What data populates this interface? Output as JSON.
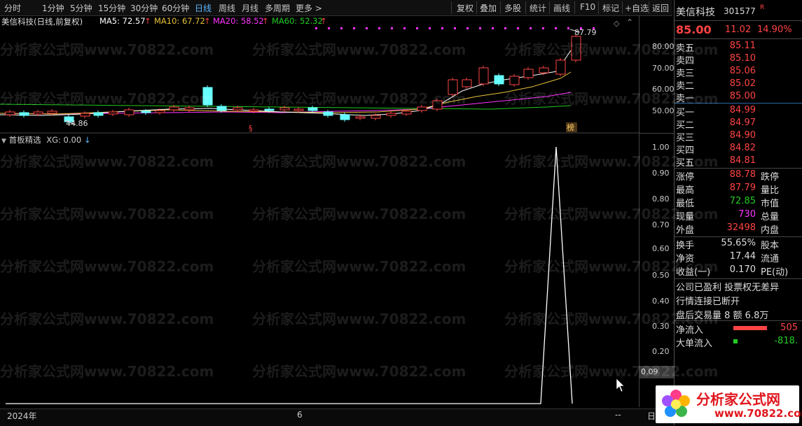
{
  "toolbar": {
    "periods": [
      "分时",
      "1分钟",
      "5分钟",
      "15分钟",
      "30分钟",
      "60分钟",
      "日线",
      "周线",
      "月线",
      "多周期",
      "更多 >"
    ],
    "active_period": "日线",
    "actions": [
      "复权",
      "叠加",
      "多股",
      "统计",
      "画线",
      "F10",
      "标记",
      "+自选",
      "返回"
    ]
  },
  "chart_header": {
    "title": "美信科技(日线,前复权)",
    "ma5": "MA5: 72.57",
    "ma10": "MA10: 67.72",
    "ma20": "MA20: 58.52",
    "ma60": "MA60: 52.32",
    "arrow_up": "↑",
    "ma_colors": {
      "ma5": "#ffffff",
      "ma10": "#e8c23a",
      "ma20": "#ff33ff",
      "ma60": "#22cc22"
    }
  },
  "price_axis": {
    "ticks": [
      "80.00",
      "70.00",
      "60.00",
      "50.00"
    ]
  },
  "price_annotations": {
    "high_label": "87.79",
    "low_label": "44.86",
    "marker_s": "§",
    "marker_bang": "榜"
  },
  "indicator": {
    "title": "首板精选",
    "xg_label": "XG: 0.00",
    "arrow": "↓",
    "ticks": [
      "1.00",
      "0.90",
      "0.80",
      "0.70",
      "0.60",
      "0.50",
      "0.40",
      "0.30",
      "0.20"
    ],
    "current_value": "0.09"
  },
  "chart_data": {
    "type": "line",
    "series": [
      {
        "name": "XG",
        "values": [
          0,
          0,
          0,
          0,
          0,
          0,
          0,
          0,
          0,
          0,
          0,
          0,
          0,
          0,
          0,
          0,
          0,
          0,
          0,
          0,
          0,
          0,
          0,
          0,
          0,
          0,
          0,
          0,
          0,
          0,
          0,
          0,
          0,
          0,
          0,
          0,
          1,
          0
        ]
      }
    ],
    "ylim": [
      0,
      1
    ],
    "x_labels": [
      "2024年",
      "6"
    ]
  },
  "bottom": {
    "year_label": "2024年",
    "month_label": "6",
    "dash": "--",
    "day_btn": "日"
  },
  "quote": {
    "name": "美信科技",
    "code": "301577",
    "badge": "R",
    "price": "85.00",
    "change": "11.02",
    "change_pct": "14.90%",
    "asks": [
      {
        "label": "卖五",
        "price": "85.11"
      },
      {
        "label": "卖四",
        "price": "85.10"
      },
      {
        "label": "卖三",
        "price": "85.06"
      },
      {
        "label": "卖二",
        "price": "85.02"
      },
      {
        "label": "卖一",
        "price": "85.00"
      }
    ],
    "bids": [
      {
        "label": "买一",
        "price": "84.99"
      },
      {
        "label": "买二",
        "price": "84.97"
      },
      {
        "label": "买三",
        "price": "84.90"
      },
      {
        "label": "买四",
        "price": "84.82"
      },
      {
        "label": "买五",
        "price": "84.81"
      }
    ],
    "stats": [
      {
        "label": "涨停",
        "value": "88.78",
        "color": "#ff4444",
        "label2": "跌停"
      },
      {
        "label": "最高",
        "value": "87.79",
        "color": "#ff4444",
        "label2": "量比"
      },
      {
        "label": "最低",
        "value": "72.85",
        "color": "#22cc22",
        "label2": "市值"
      },
      {
        "label": "现量",
        "value": "730",
        "color": "#ff33ff",
        "label2": "总量"
      },
      {
        "label": "外盘",
        "value": "32498",
        "color": "#ff4444",
        "label2": "内盘"
      }
    ],
    "fin": [
      {
        "label": "换手",
        "value": "55.65%",
        "label2": "股本"
      },
      {
        "label": "净资",
        "value": "17.44",
        "label2": "流通"
      },
      {
        "label": "收益(一)",
        "value": "0.170",
        "label2": "PE(动)"
      }
    ],
    "notes": [
      "公司已盈利 投票权无差异",
      "行情连接已断开",
      "盘后交易量 8 额 6.8万"
    ],
    "flows": [
      {
        "label": "净流入",
        "value": "505",
        "color": "#ff4444"
      },
      {
        "label": "大单流入",
        "value": "-818.",
        "color": "#22cc22"
      }
    ]
  },
  "watermark": {
    "text1": "分析家公式网www.70822.com"
  },
  "logo": {
    "text": "分析家公式网",
    "url_text": "www.70822.com"
  }
}
